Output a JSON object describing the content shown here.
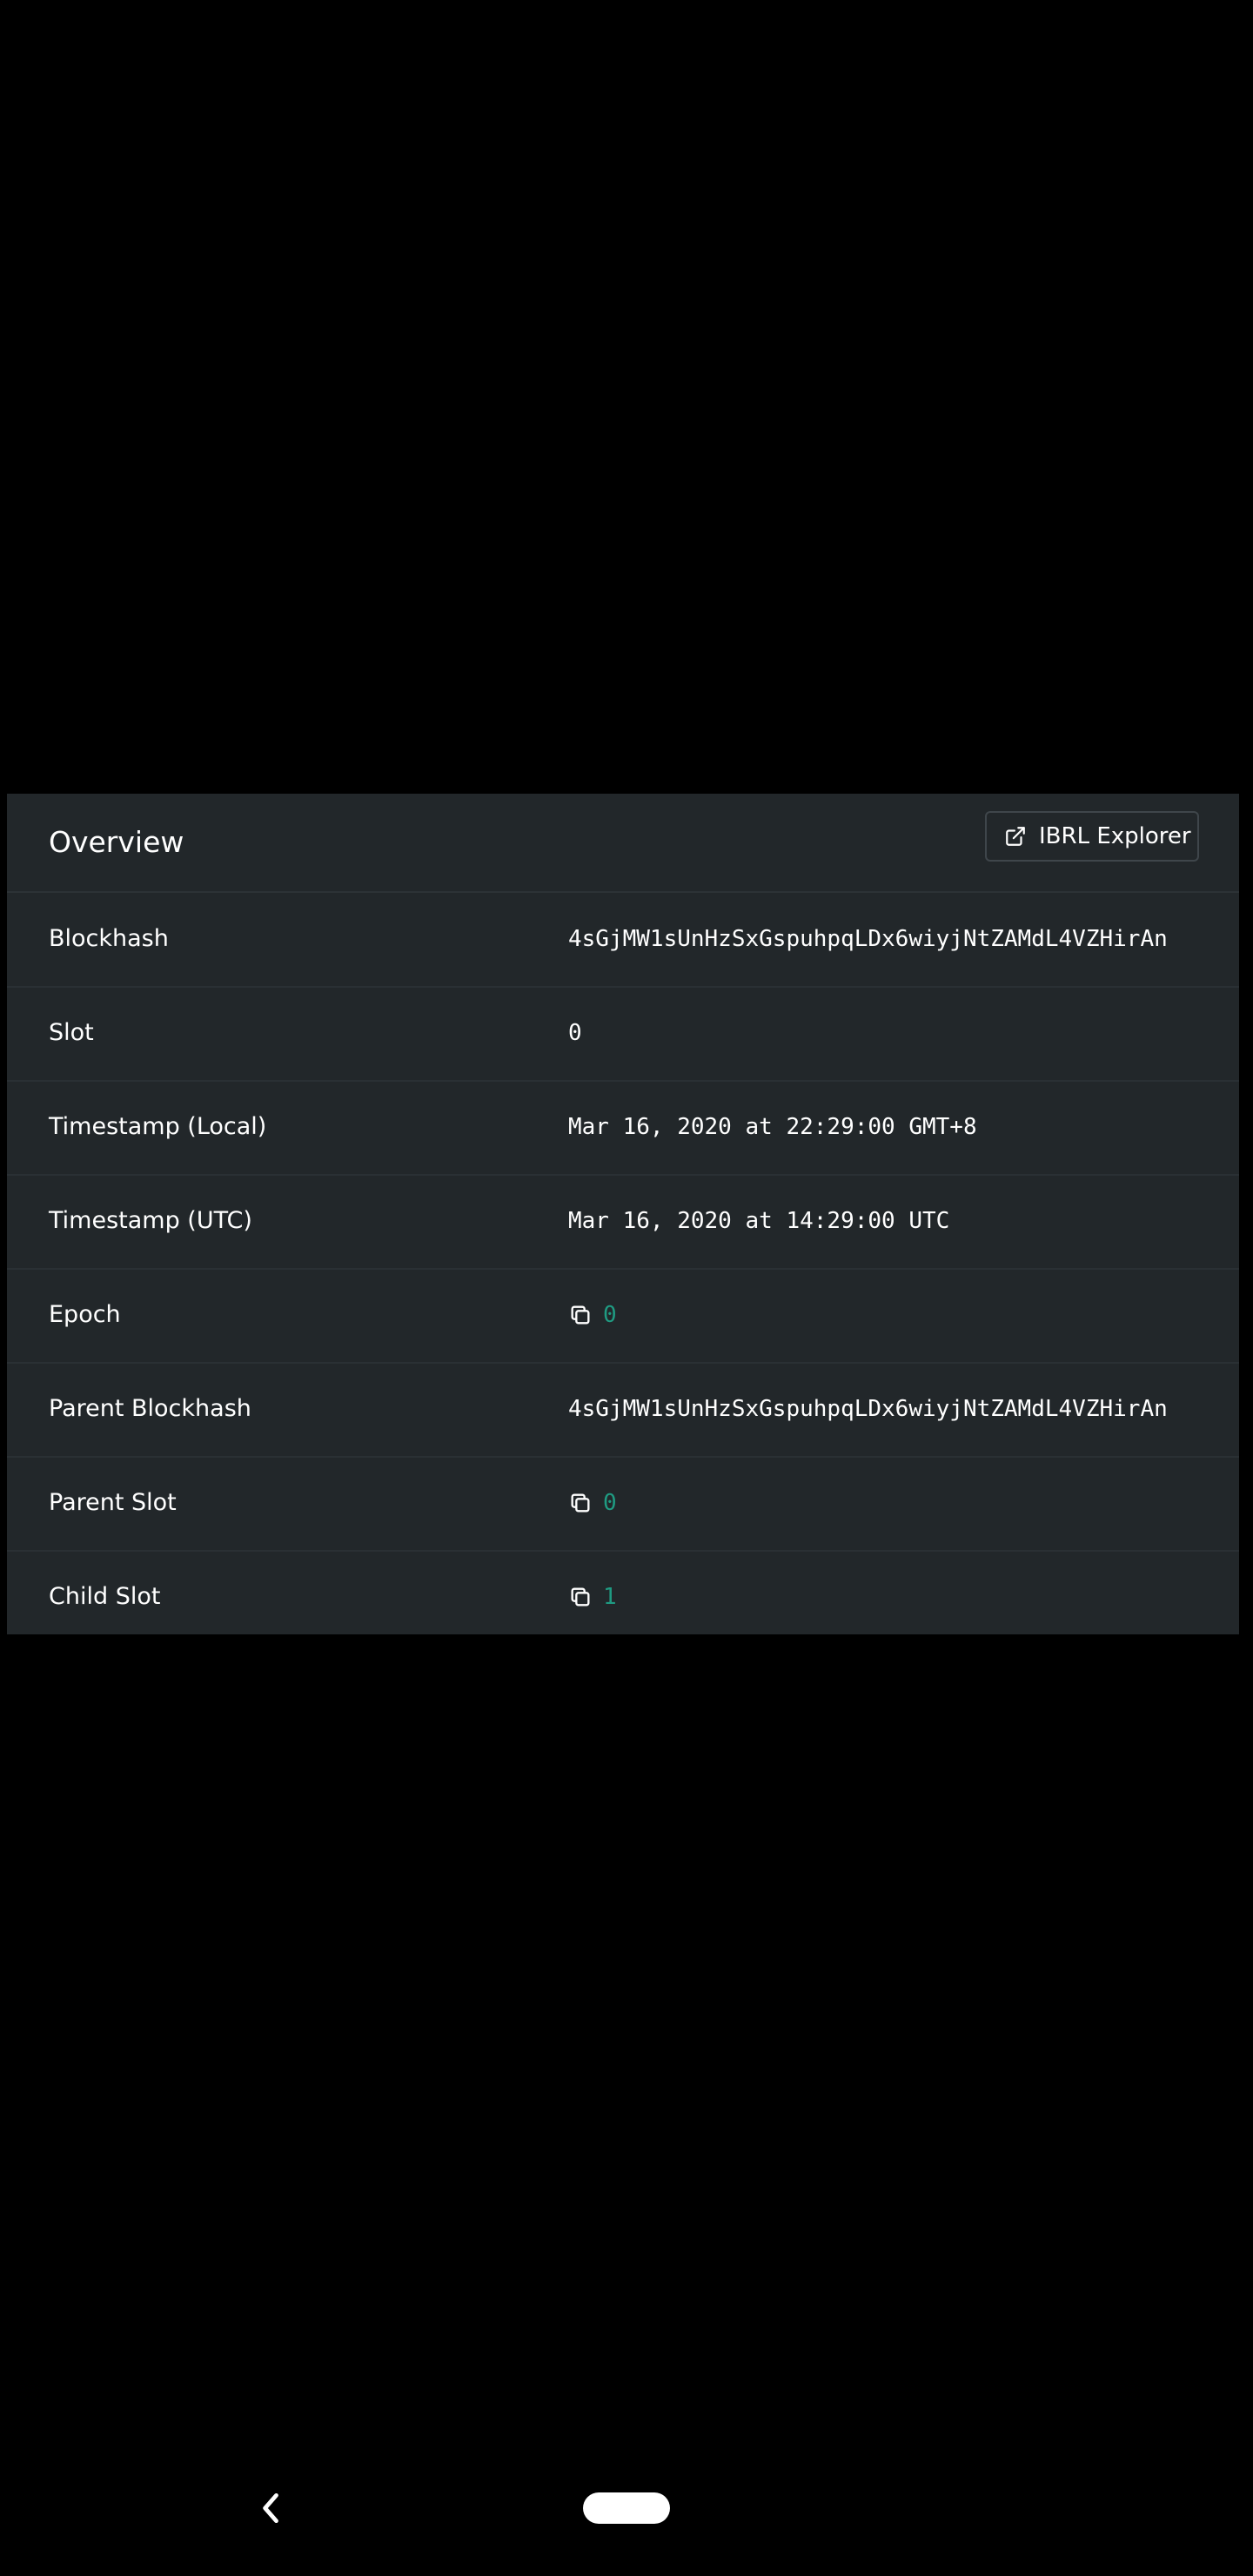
{
  "overview": {
    "title": "Overview",
    "explorer_button_label": "IBRL Explorer",
    "rows": [
      {
        "label": "Blockhash",
        "value": "4sGjMW1sUnHzSxGspuhpqLDx6wiyjNtZAMdL4VZHirAn"
      },
      {
        "label": "Slot",
        "value": "0"
      },
      {
        "label": "Timestamp (Local)",
        "value": "Mar 16, 2020 at 22:29:00 GMT+8"
      },
      {
        "label": "Timestamp (UTC)",
        "value": "Mar 16, 2020 at 14:29:00 UTC"
      },
      {
        "label": "Epoch",
        "value": "0"
      },
      {
        "label": "Parent Blockhash",
        "value": "4sGjMW1sUnHzSxGspuhpqLDx6wiyjNtZAMdL4VZHirAn"
      },
      {
        "label": "Parent Slot",
        "value": "0"
      },
      {
        "label": "Child Slot",
        "value": "1"
      }
    ]
  },
  "colors": {
    "background": "#000000",
    "card": "#22272a",
    "link": "#1f9b82",
    "text": "#ffffff"
  },
  "icons": {
    "explorer": "external-link-icon",
    "copy": "copy-icon",
    "back": "chevron-left-icon"
  }
}
